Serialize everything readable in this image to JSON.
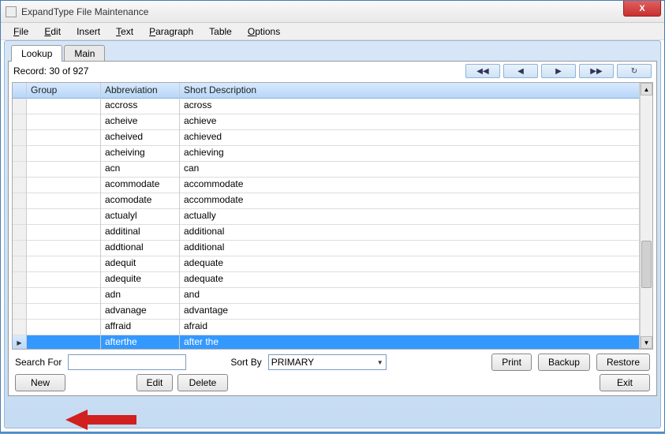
{
  "window": {
    "title": "ExpandType File Maintenance",
    "close_x": "X"
  },
  "menu": {
    "file": "File",
    "edit": "Edit",
    "insert": "Insert",
    "text": "Text",
    "paragraph": "Paragraph",
    "table": "Table",
    "options": "Options"
  },
  "tabs": {
    "lookup": "Lookup",
    "main": "Main"
  },
  "record_label": "Record: 30 of 927",
  "nav": {
    "first": "◀◀",
    "prev": "◀",
    "next": "▶",
    "last": "▶▶",
    "refresh": "↻"
  },
  "columns": {
    "group": "Group",
    "abbrev": "Abbreviation",
    "desc": "Short Description"
  },
  "rows": [
    {
      "group": "",
      "abbrev": "accross",
      "desc": "across",
      "sel": false
    },
    {
      "group": "",
      "abbrev": "acheive",
      "desc": "achieve",
      "sel": false
    },
    {
      "group": "",
      "abbrev": "acheived",
      "desc": "achieved",
      "sel": false
    },
    {
      "group": "",
      "abbrev": "acheiving",
      "desc": "achieving",
      "sel": false
    },
    {
      "group": "",
      "abbrev": "acn",
      "desc": "can",
      "sel": false
    },
    {
      "group": "",
      "abbrev": "acommodate",
      "desc": "accommodate",
      "sel": false
    },
    {
      "group": "",
      "abbrev": "acomodate",
      "desc": "accommodate",
      "sel": false
    },
    {
      "group": "",
      "abbrev": "actualyl",
      "desc": "actually",
      "sel": false
    },
    {
      "group": "",
      "abbrev": "additinal",
      "desc": "additional",
      "sel": false
    },
    {
      "group": "",
      "abbrev": "addtional",
      "desc": "additional",
      "sel": false
    },
    {
      "group": "",
      "abbrev": "adequit",
      "desc": "adequate",
      "sel": false
    },
    {
      "group": "",
      "abbrev": "adequite",
      "desc": "adequate",
      "sel": false
    },
    {
      "group": "",
      "abbrev": "adn",
      "desc": "and",
      "sel": false
    },
    {
      "group": "",
      "abbrev": "advanage",
      "desc": "advantage",
      "sel": false
    },
    {
      "group": "",
      "abbrev": "affraid",
      "desc": "afraid",
      "sel": false
    },
    {
      "group": "",
      "abbrev": "afterthe",
      "desc": "after the",
      "sel": true
    }
  ],
  "search": {
    "label": "Search For",
    "value": "",
    "sortby_label": "Sort By",
    "sortby_value": "PRIMARY"
  },
  "buttons": {
    "print": "Print",
    "backup": "Backup",
    "restore": "Restore",
    "new": "New",
    "edit": "Edit",
    "delete": "Delete",
    "exit": "Exit"
  }
}
